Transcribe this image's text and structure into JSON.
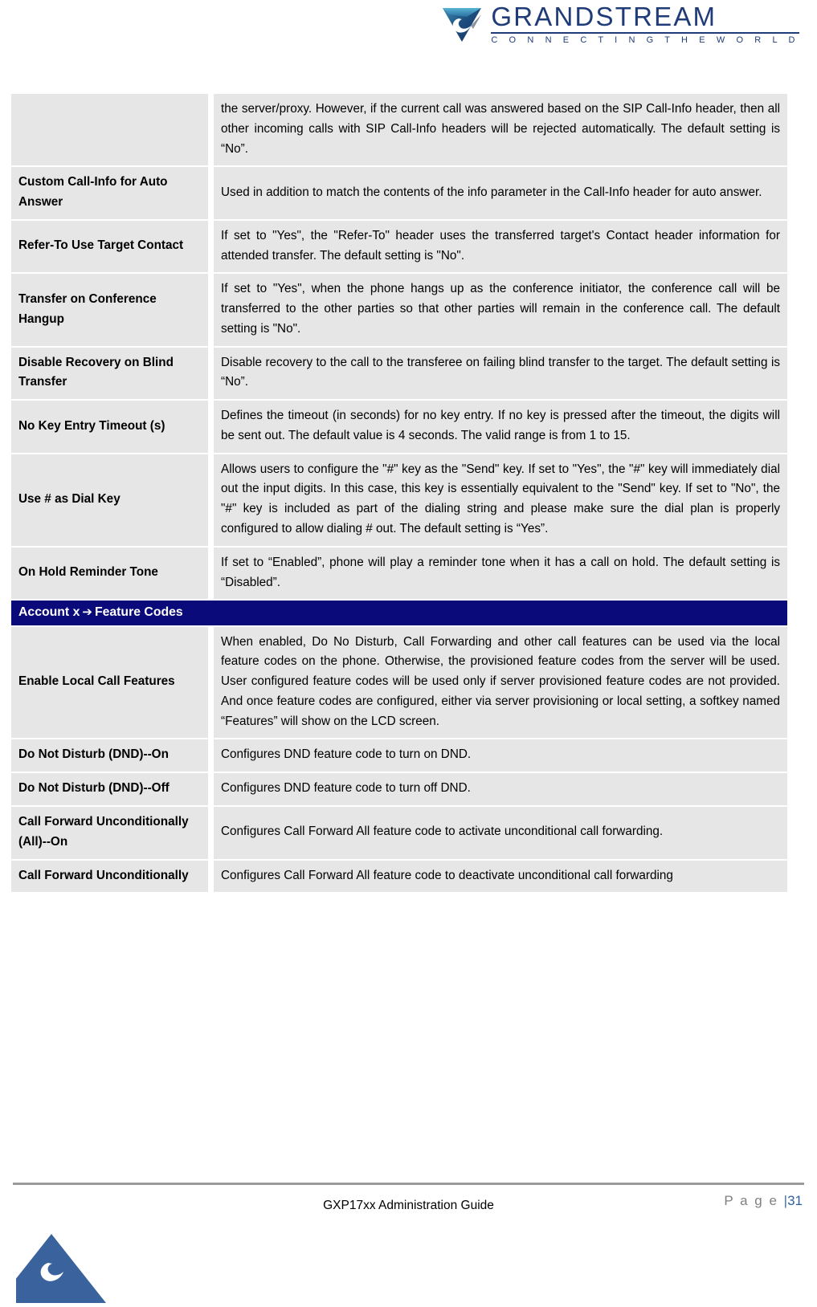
{
  "header": {
    "logo_icon": "grandstream-swoosh-logo",
    "brand": "GRANDSTREAM",
    "tagline": "C O N N E C T I N G   T H E   W O R L D",
    "brand_color": "#1f3c78"
  },
  "table": {
    "rows": [
      {
        "label": "",
        "description": "the server/proxy. However, if the current call was answered based on the SIP Call-Info header, then all other incoming calls with SIP Call-Info headers will be rejected automatically. The default setting is “No”."
      },
      {
        "label": "Custom Call-Info for Auto Answer",
        "description": "Used in addition to match the contents of the info parameter in the Call-Info header for auto answer."
      },
      {
        "label": "Refer-To Use Target Contact",
        "description": "If set to \"Yes\", the \"Refer-To\" header uses the transferred target's Contact header information for attended transfer. The default setting is \"No\"."
      },
      {
        "label": "Transfer on Conference Hangup",
        "description": "If set to \"Yes\", when the phone hangs up as the conference initiator, the conference call will be transferred to the other parties so that other parties will remain in the conference call. The default setting is \"No\"."
      },
      {
        "label": "Disable Recovery on Blind Transfer",
        "description": "Disable recovery to the call to the transferee on failing blind transfer to the target. The default setting is “No”."
      },
      {
        "label": "No Key Entry Timeout (s)",
        "description": "Defines the timeout (in seconds) for no key entry. If no key is pressed after the timeout, the digits will be sent out. The default value is 4 seconds. The valid range is from 1 to 15."
      },
      {
        "label": "Use # as Dial Key",
        "description": "Allows users to configure the \"#\" key as the \"Send\" key. If set to \"Yes\", the \"#\" key will immediately dial out the input digits. In this case, this key is essentially equivalent to the \"Send\" key. If set to \"No\", the \"#\" key is included as part of the dialing string and please make sure the dial plan is properly configured to allow dialing # out. The default setting is “Yes”."
      },
      {
        "label": "On Hold Reminder Tone",
        "description": "If set to “Enabled”, phone will play a reminder tone when it has a call on hold. The default setting is “Disabled”."
      }
    ],
    "section_bar": {
      "prefix": "Account x",
      "arrow": "➔",
      "suffix": "Feature Codes",
      "background": "#0a0a7a",
      "text_color": "#ffffff"
    },
    "rows2": [
      {
        "label": "Enable Local Call Features",
        "description": "When enabled, Do No Disturb, Call Forwarding and other call features can be used via the local feature codes on the phone. Otherwise, the provisioned feature codes from the server will be used. User configured feature codes will be used only if server provisioned feature codes are not provided. And once feature codes are configured, either via server provisioning or local setting, a softkey named “Features” will show on the LCD screen."
      },
      {
        "label": "Do Not Disturb (DND)--On",
        "description": "Configures DND feature code to turn on DND."
      },
      {
        "label": "Do Not Disturb (DND)--Off",
        "description": "Configures DND feature code to turn off DND."
      },
      {
        "label": "Call Forward Unconditionally (All)--On",
        "description": "Configures Call Forward All feature code to activate unconditional call forwarding."
      },
      {
        "label": "Call Forward Unconditionally",
        "description": "Configures Call Forward All feature code to deactivate unconditional call forwarding"
      }
    ]
  },
  "footer": {
    "guide_title": "GXP17xx Administration Guide",
    "page_label": "P a g e ",
    "page_separator": "|",
    "page_number": "31",
    "logo_icon": "grandstream-triangle-logo"
  }
}
